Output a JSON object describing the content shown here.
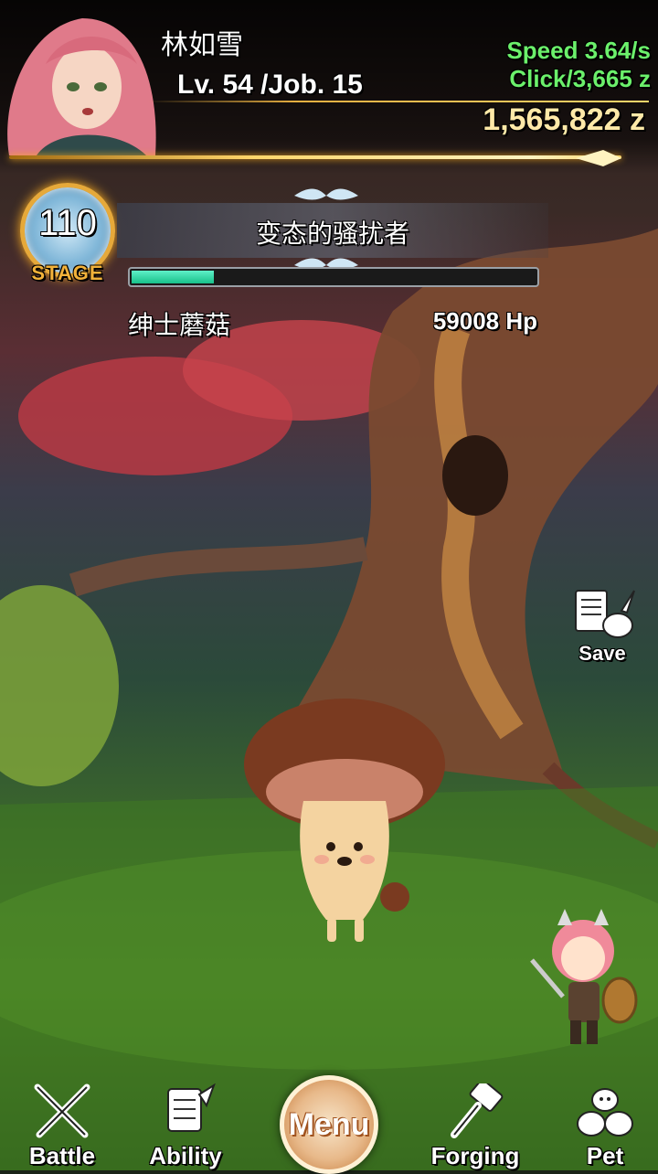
{
  "player": {
    "name": "林如雪",
    "level_line": "Lv. 54 /Job. 15"
  },
  "stats": {
    "speed": "Speed 3.64/s",
    "click": "Click/3,665 z",
    "gold": "1,565,822 z"
  },
  "stage": {
    "number": "110",
    "label": "STAGE",
    "boss_title": "变态的骚扰者"
  },
  "enemy": {
    "name": "绅士蘑菇",
    "hp": "59008 Hp",
    "hp_fraction": 0.21
  },
  "actions": {
    "save_label": "Save"
  },
  "nav": {
    "battle": "Battle",
    "ability": "Ability",
    "menu": "Menu",
    "forging": "Forging",
    "pet": "Pet"
  },
  "colors": {
    "speed_text": "#6bf06b",
    "gold_text": "#ffe9a8",
    "hp_fill": "#2fd8a0"
  },
  "icons": {
    "battle": "crossed-swords-icon",
    "ability": "scroll-icon",
    "forging": "hammer-icon",
    "pet": "pet-group-icon",
    "save": "scroll-save-icon"
  }
}
